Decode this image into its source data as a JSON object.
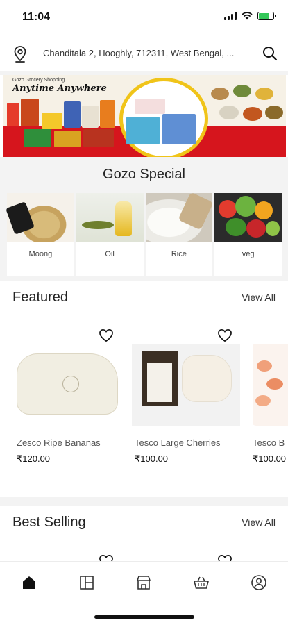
{
  "status_bar": {
    "time": "11:04"
  },
  "location": {
    "address": "Chanditala 2, Hooghly, 712311, West Bengal, ..."
  },
  "banner": {
    "small_text": "Gozo Grocery Shopping",
    "tagline": "Anytime Anywhere"
  },
  "gozo_special": {
    "title": "Gozo Special",
    "items": [
      {
        "label": "Moong"
      },
      {
        "label": "Oil"
      },
      {
        "label": "Rice"
      },
      {
        "label": "veg"
      }
    ]
  },
  "featured": {
    "title": "Featured",
    "view_all": "View All",
    "products": [
      {
        "name": "Zesco Ripe Bananas",
        "price": "₹120.00"
      },
      {
        "name": "Tesco Large Cherries",
        "price": "₹100.00"
      },
      {
        "name": "Tesco B",
        "price": "₹100.00"
      }
    ]
  },
  "best_selling": {
    "title": "Best Selling",
    "view_all": "View All"
  },
  "bottom_nav": {
    "items": [
      {
        "icon": "home-icon",
        "active": true
      },
      {
        "icon": "categories-icon",
        "active": false
      },
      {
        "icon": "store-icon",
        "active": false
      },
      {
        "icon": "basket-icon",
        "active": false
      },
      {
        "icon": "profile-icon",
        "active": false
      }
    ]
  }
}
